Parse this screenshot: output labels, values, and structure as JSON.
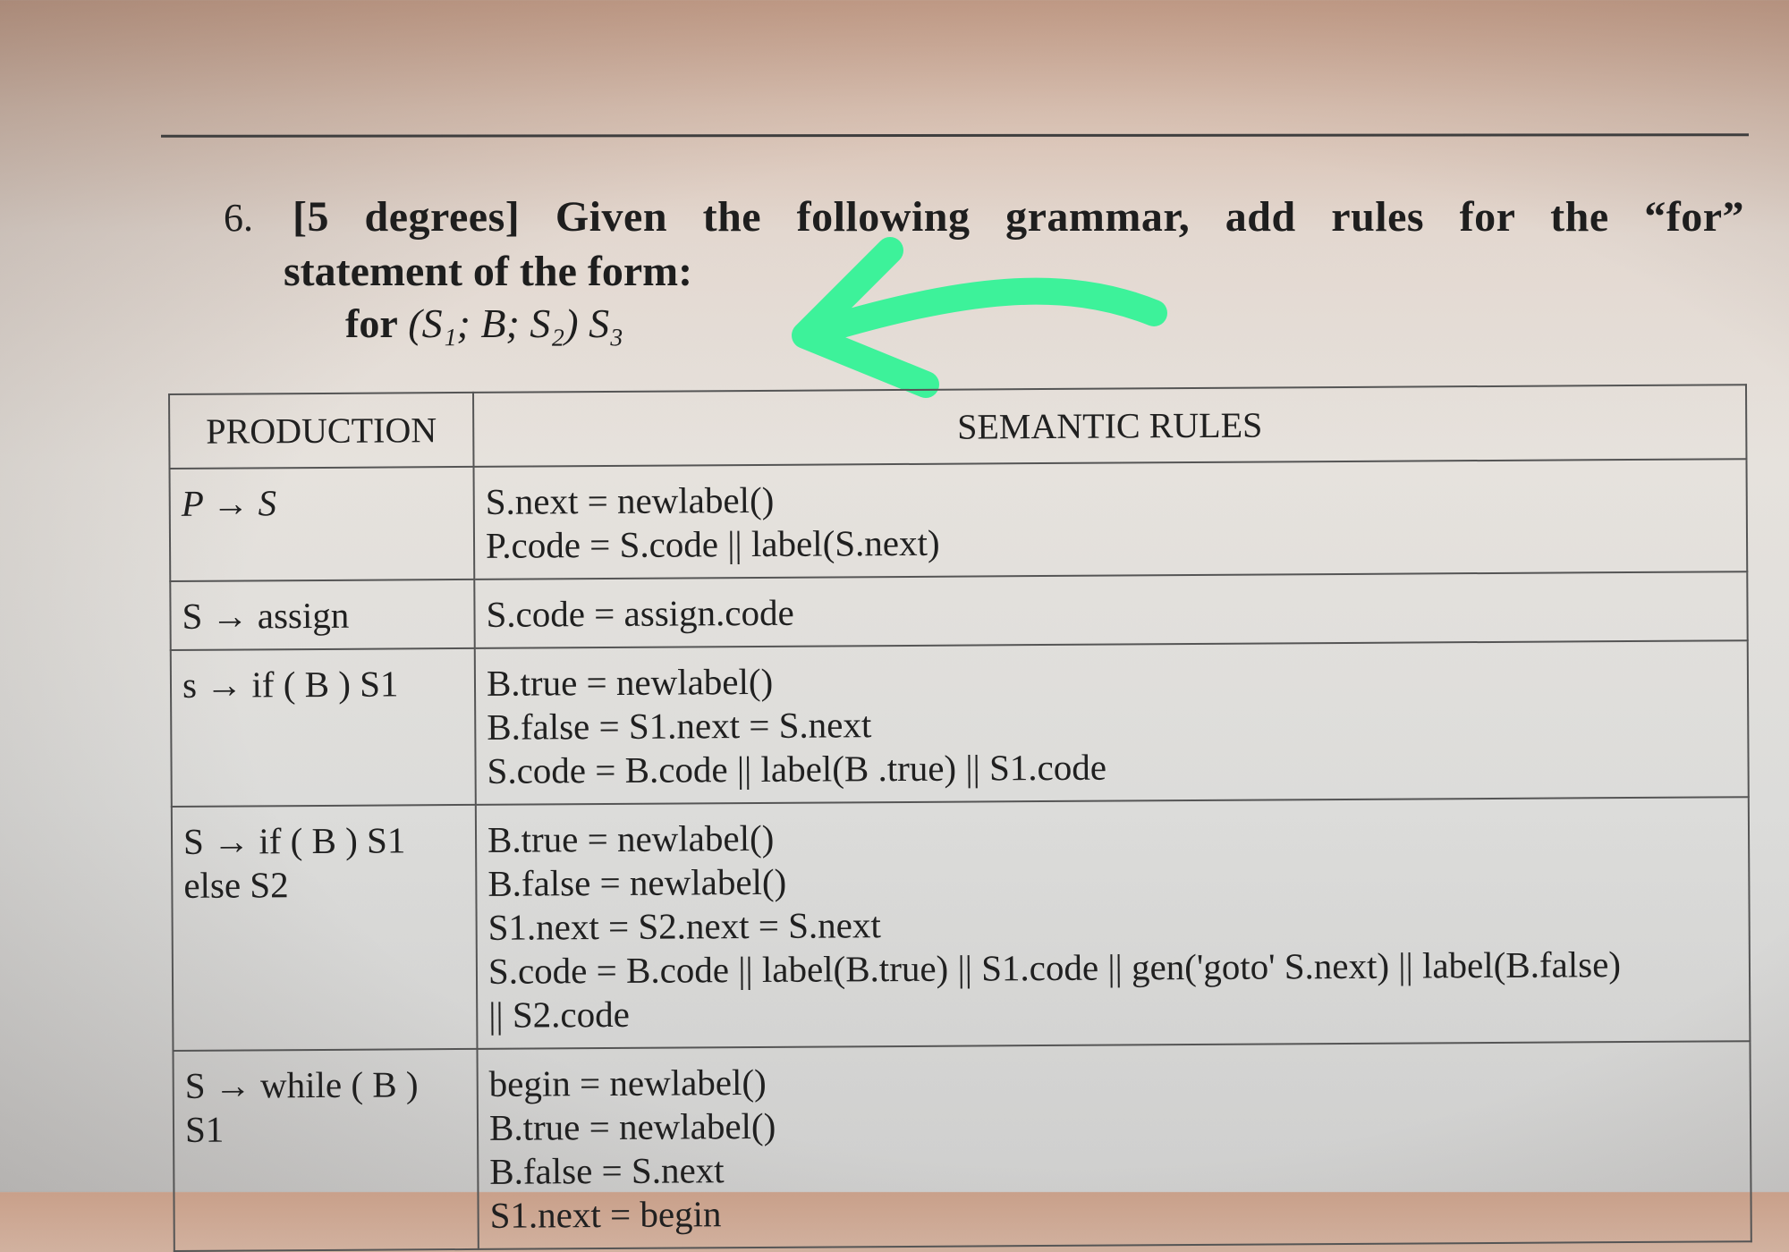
{
  "question": {
    "number": "6.",
    "line1": "[5 degrees] Given the following grammar, add rules for the “for”",
    "line2": "statement of the form:",
    "form_keyword": "for",
    "form_expr": "(S₁; B; S₂) S₃"
  },
  "annotation": {
    "color": "#3df29a",
    "shape": "arrow-pointing-left"
  },
  "table": {
    "headers": {
      "production": "PRODUCTION",
      "semantic_rules": "SEMANTIC RULES"
    },
    "rows": [
      {
        "production": "P → S",
        "rules": [
          "S.next = newlabel()",
          "P.code = S.code || label(S.next)"
        ]
      },
      {
        "production": "S → assign",
        "rules": [
          "S.code = assign.code"
        ]
      },
      {
        "production": "s → if ( B ) S1",
        "rules": [
          "B.true = newlabel()",
          "B.false = S1.next = S.next",
          "S.code = B.code || label(B .true) || S1.code"
        ]
      },
      {
        "production": "S → if ( B ) S1\nelse S2",
        "rules": [
          "B.true = newlabel()",
          "B.false = newlabel()",
          "S1.next = S2.next = S.next",
          "S.code = B.code || label(B.true) || S1.code || gen('goto' S.next) || label(B.false)",
          "|| S2.code"
        ]
      },
      {
        "production": "S → while ( B ) S1",
        "rules": [
          "begin = newlabel()",
          "B.true = newlabel()",
          "B.false = S.next",
          "S1.next = begin"
        ]
      }
    ]
  }
}
